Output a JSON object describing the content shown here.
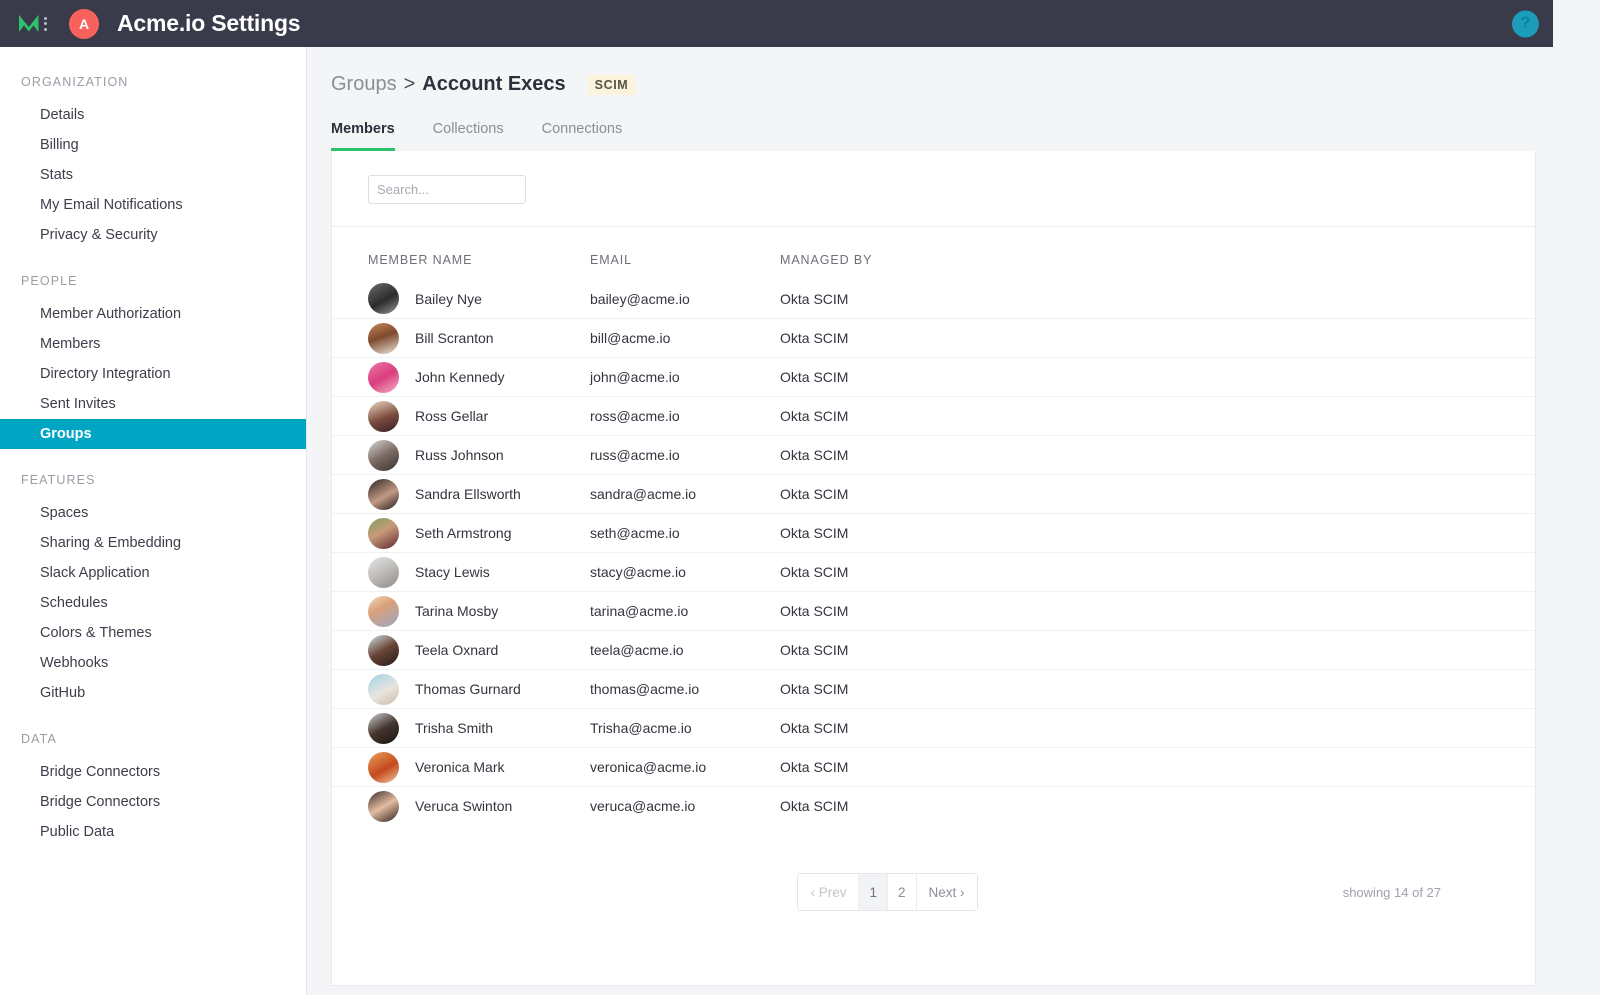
{
  "topbar": {
    "logo_icon": "mode-analytics-m-logo",
    "menu_icon": "vertical-dots-icon",
    "org_initial": "A",
    "title": "Acme.io Settings",
    "help_label": "?"
  },
  "sidebar": {
    "sections": [
      {
        "title": "ORGANIZATION",
        "items": [
          {
            "label": "Details",
            "active": false
          },
          {
            "label": "Billing",
            "active": false
          },
          {
            "label": "Stats",
            "active": false
          },
          {
            "label": "My Email Notifications",
            "active": false
          },
          {
            "label": "Privacy & Security",
            "active": false
          }
        ]
      },
      {
        "title": "PEOPLE",
        "items": [
          {
            "label": "Member Authorization",
            "active": false
          },
          {
            "label": "Members",
            "active": false
          },
          {
            "label": "Directory Integration",
            "active": false
          },
          {
            "label": "Sent Invites",
            "active": false
          },
          {
            "label": "Groups",
            "active": true
          }
        ]
      },
      {
        "title": "FEATURES",
        "items": [
          {
            "label": "Spaces",
            "active": false
          },
          {
            "label": "Sharing & Embedding",
            "active": false
          },
          {
            "label": "Slack Application",
            "active": false
          },
          {
            "label": "Schedules",
            "active": false
          },
          {
            "label": "Colors & Themes",
            "active": false
          },
          {
            "label": "Webhooks",
            "active": false
          },
          {
            "label": "GitHub",
            "active": false
          }
        ]
      },
      {
        "title": "DATA",
        "items": [
          {
            "label": "Bridge Connectors",
            "active": false
          },
          {
            "label": "Bridge Connectors",
            "active": false
          },
          {
            "label": "Public Data",
            "active": false
          }
        ]
      }
    ]
  },
  "page": {
    "breadcrumb_parent": "Groups",
    "breadcrumb_separator": ">",
    "breadcrumb_current": "Account Execs",
    "badge": "SCIM",
    "tabs": [
      {
        "label": "Members",
        "active": true
      },
      {
        "label": "Collections",
        "active": false
      },
      {
        "label": "Connections",
        "active": false
      }
    ]
  },
  "search": {
    "value": "",
    "placeholder": "Search...",
    "icon": "search-icon"
  },
  "table": {
    "columns": [
      "MEMBER NAME",
      "EMAIL",
      "MANAGED BY"
    ],
    "rows": [
      {
        "name": "Bailey Nye",
        "email": "bailey@acme.io",
        "managed_by": "Okta SCIM",
        "avatar": "linear-gradient(150deg,#6e6e70,#2c2c2e 55%,#9a9a9c)"
      },
      {
        "name": "Bill Scranton",
        "email": "bill@acme.io",
        "managed_by": "Okta SCIM",
        "avatar": "linear-gradient(160deg,#c98a5a,#7d4a2c 45%,#efe7e0)"
      },
      {
        "name": "John Kennedy",
        "email": "john@acme.io",
        "managed_by": "Okta SCIM",
        "avatar": "linear-gradient(150deg,#f07aa8,#d93d7d 50%,#f2b6c8)"
      },
      {
        "name": "Ross Gellar",
        "email": "ross@acme.io",
        "managed_by": "Okta SCIM",
        "avatar": "linear-gradient(160deg,#f0d9c5,#7a4a3c 55%,#33202a)"
      },
      {
        "name": "Russ Johnson",
        "email": "russ@acme.io",
        "managed_by": "Okta SCIM",
        "avatar": "linear-gradient(150deg,#d8d8da,#7c6c64 50%,#3b3330)"
      },
      {
        "name": "Sandra Ellsworth",
        "email": "sandra@acme.io",
        "managed_by": "Okta SCIM",
        "avatar": "linear-gradient(150deg,#2b2220,#c39a84 55%,#1e1a18)"
      },
      {
        "name": "Seth Armstrong",
        "email": "seth@acme.io",
        "managed_by": "Okta SCIM",
        "avatar": "linear-gradient(150deg,#7d9c5e,#c79a78 45%,#5c2630)"
      },
      {
        "name": "Stacy Lewis",
        "email": "stacy@acme.io",
        "managed_by": "Okta SCIM",
        "avatar": "linear-gradient(150deg,#e6e6e8,#b9b6b2 55%,#8e8b88)"
      },
      {
        "name": "Tarina Mosby",
        "email": "tarina@acme.io",
        "managed_by": "Okta SCIM",
        "avatar": "linear-gradient(150deg,#f3d9c0,#d8a07a 40%,#9aa8c8)"
      },
      {
        "name": "Teela Oxnard",
        "email": "teela@acme.io",
        "managed_by": "Okta SCIM",
        "avatar": "linear-gradient(150deg,#cfe2e6,#6a4436 50%,#241a16)"
      },
      {
        "name": "Thomas Gurnard",
        "email": "thomas@acme.io",
        "managed_by": "Okta SCIM",
        "avatar": "linear-gradient(150deg,#9fd3e8,#e8e4de 55%,#c9b9a4)"
      },
      {
        "name": "Trisha Smith",
        "email": "Trisha@acme.io",
        "managed_by": "Okta SCIM",
        "avatar": "linear-gradient(150deg,#cfd3d6,#45352e 50%,#181412)"
      },
      {
        "name": "Veronica Mark",
        "email": "veronica@acme.io",
        "managed_by": "Okta SCIM",
        "avatar": "linear-gradient(150deg,#e8a25a,#c4491e 55%,#f0c9a0)"
      },
      {
        "name": "Veruca Swinton",
        "email": "veruca@acme.io",
        "managed_by": "Okta SCIM",
        "avatar": "linear-gradient(150deg,#3a2a24,#e3bda2 50%,#2a1e1a)"
      }
    ]
  },
  "pagination": {
    "prev_label": "‹ Prev",
    "pages": [
      "1",
      "2"
    ],
    "active_page": "1",
    "next_label": "Next ›",
    "showing_text": "showing 14 of 27"
  },
  "colors": {
    "topbar_bg": "#393b4a",
    "sidebar_active": "#00a5c4",
    "tab_underline": "#2ec16b",
    "org_avatar": "#f9615c",
    "help_circle": "#1b9cb9",
    "badge_bg": "#fcf3dd",
    "logo_green": "#2ec16b"
  }
}
